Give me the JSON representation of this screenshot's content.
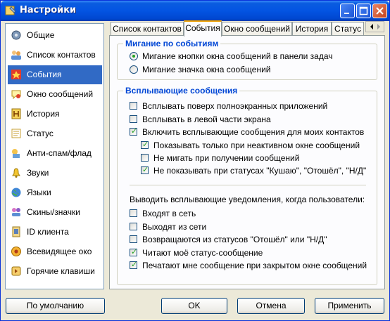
{
  "window": {
    "title": "Настройки"
  },
  "sidebar": {
    "items": [
      {
        "label": "Общие",
        "icon": "gear-icon"
      },
      {
        "label": "Список контактов",
        "icon": "contacts-icon"
      },
      {
        "label": "События",
        "icon": "events-icon"
      },
      {
        "label": "Окно сообщений",
        "icon": "message-window-icon"
      },
      {
        "label": "История",
        "icon": "history-icon"
      },
      {
        "label": "Статус",
        "icon": "status-icon"
      },
      {
        "label": "Анти-спам/флад",
        "icon": "antispam-icon"
      },
      {
        "label": "Звуки",
        "icon": "sound-icon"
      },
      {
        "label": "Языки",
        "icon": "languages-icon"
      },
      {
        "label": "Скины/значки",
        "icon": "skins-icon"
      },
      {
        "label": "ID клиента",
        "icon": "client-id-icon"
      },
      {
        "label": "Всевидящее око",
        "icon": "eye-icon"
      },
      {
        "label": "Горячие клавиши",
        "icon": "hotkeys-icon"
      }
    ],
    "selected_index": 2
  },
  "tabs": [
    "Список контактов",
    "События",
    "Окно сообщений",
    "История",
    "Статус"
  ],
  "active_tab": "События",
  "flash_group": {
    "title": "Мигание по событиям",
    "options": [
      {
        "label": "Мигание кнопки окна сообщений в панели задач",
        "checked": true
      },
      {
        "label": "Мигание значка окна сообщений",
        "checked": false
      }
    ]
  },
  "popup_group": {
    "title": "Всплывающие сообщения",
    "options": [
      {
        "label": "Всплывать поверх полноэкранных приложений",
        "checked": false
      },
      {
        "label": "Всплывать в левой части экрана",
        "checked": false
      },
      {
        "label": "Включить всплывающие сообщения для моих контактов",
        "checked": true
      },
      {
        "label": "Показывать только при неактивном окне сообщений",
        "checked": true
      },
      {
        "label": "Не мигать при получении сообщений",
        "checked": false
      },
      {
        "label": "Не показывать при статусах \"Кушаю\", \"Отошёл\", \"Н/Д\"",
        "checked": true
      }
    ],
    "notify_caption": "Выводить всплывающие уведомления, когда пользователи:",
    "notify_options": [
      {
        "label": "Входят в сеть",
        "checked": false
      },
      {
        "label": "Выходят из сети",
        "checked": false
      },
      {
        "label": "Возвращаются из статусов \"Отошёл\" или \"Н/Д\"",
        "checked": false
      },
      {
        "label": "Читают моё статус-сообщение",
        "checked": true
      },
      {
        "label": "Печатают мне сообщение при закрытом окне сообщений",
        "checked": true
      }
    ]
  },
  "buttons": {
    "default": "По умолчанию",
    "ok": "OK",
    "cancel": "Отмена",
    "apply": "Применить"
  },
  "colors": {
    "accent": "#316ac5",
    "group_title": "#0046d5",
    "check": "#21a121"
  }
}
